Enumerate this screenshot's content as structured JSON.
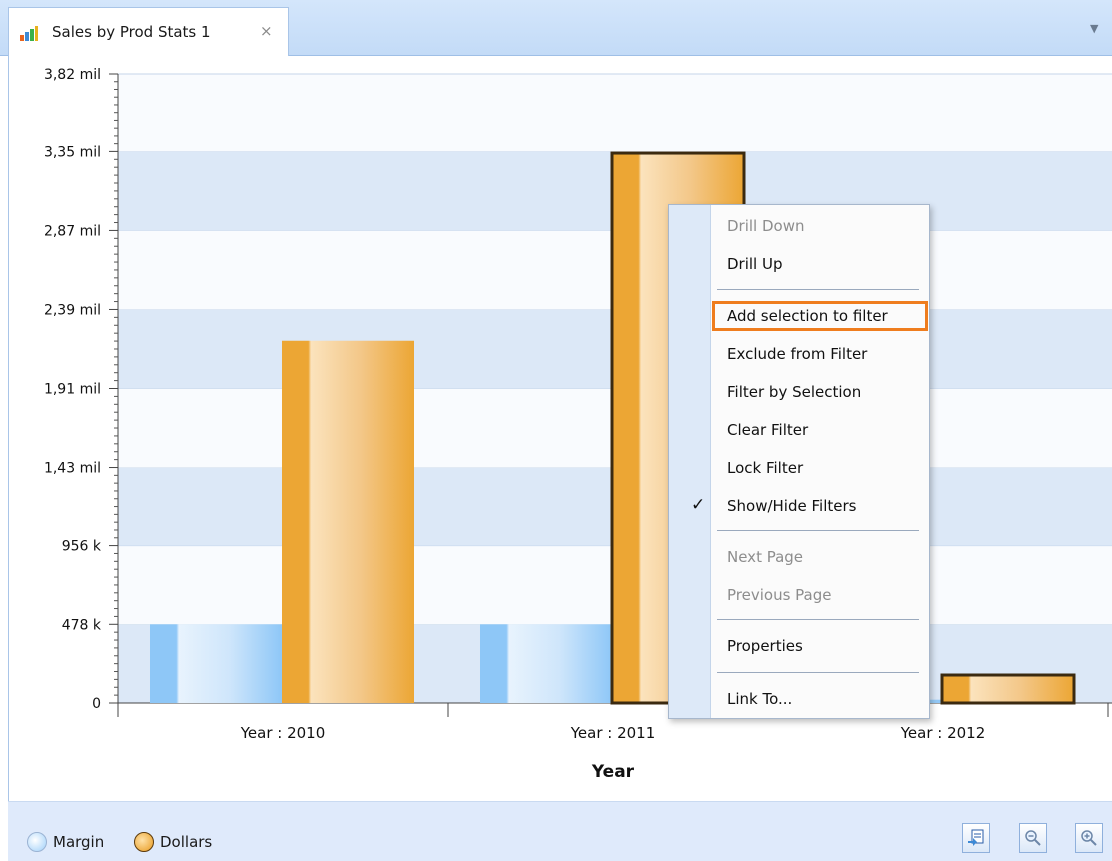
{
  "tab": {
    "title": "Sales by Prod Stats 1",
    "close": "×",
    "menu_glyph": "▼"
  },
  "chart_data": {
    "type": "bar",
    "xlabel": "Year",
    "ylabel": "",
    "ylim": [
      0,
      3820000
    ],
    "yticks": [
      {
        "value": 0,
        "label": "0"
      },
      {
        "value": 478000,
        "label": "478 k"
      },
      {
        "value": 956000,
        "label": "956 k"
      },
      {
        "value": 1430000,
        "label": "1,43 mil"
      },
      {
        "value": 1910000,
        "label": "1,91 mil"
      },
      {
        "value": 2390000,
        "label": "2,39 mil"
      },
      {
        "value": 2870000,
        "label": "2,87 mil"
      },
      {
        "value": 3350000,
        "label": "3,35 mil"
      },
      {
        "value": 3820000,
        "label": "3,82 mil"
      }
    ],
    "categories": [
      "Year : 2010",
      "Year : 2011",
      "Year : 2012"
    ],
    "series": [
      {
        "name": "Margin",
        "values": [
          478000,
          478000,
          20000
        ],
        "color": "#8ec7f7"
      },
      {
        "name": "Dollars",
        "values": [
          2200000,
          3340000,
          170000
        ],
        "color": "#eca634"
      }
    ],
    "selected_bars": [
      {
        "series": 1,
        "index": 1
      },
      {
        "series": 1,
        "index": 2
      }
    ],
    "grid": true,
    "legend": "bottom-left"
  },
  "legend": {
    "margin": "Margin",
    "dollars": "Dollars"
  },
  "context_menu": {
    "items": [
      {
        "label": "Drill Down",
        "disabled": true
      },
      {
        "label": "Drill Up",
        "disabled": false
      },
      {
        "label": "Add selection to filter",
        "disabled": false,
        "highlight": true
      },
      {
        "label": "Exclude from Filter",
        "disabled": false
      },
      {
        "label": "Filter by Selection",
        "disabled": false
      },
      {
        "label": "Clear Filter",
        "disabled": false
      },
      {
        "label": "Lock Filter",
        "disabled": false
      },
      {
        "label": "Show/Hide Filters",
        "disabled": false,
        "checked": true
      },
      {
        "label": "Next Page",
        "disabled": true
      },
      {
        "label": "Previous Page",
        "disabled": true
      },
      {
        "label": "Properties",
        "disabled": false
      },
      {
        "label": "Link To...",
        "disabled": false
      }
    ],
    "check_glyph": "✓"
  },
  "toolbar": {
    "icons": [
      "export-icon",
      "zoom-out-icon",
      "zoom-in-icon"
    ]
  },
  "colors": {
    "accent": "#ef7d1e",
    "band": "#dce8f7",
    "margin": "#8ec7f7",
    "dollars": "#eca634",
    "selected_outline": "#3b2a10"
  }
}
